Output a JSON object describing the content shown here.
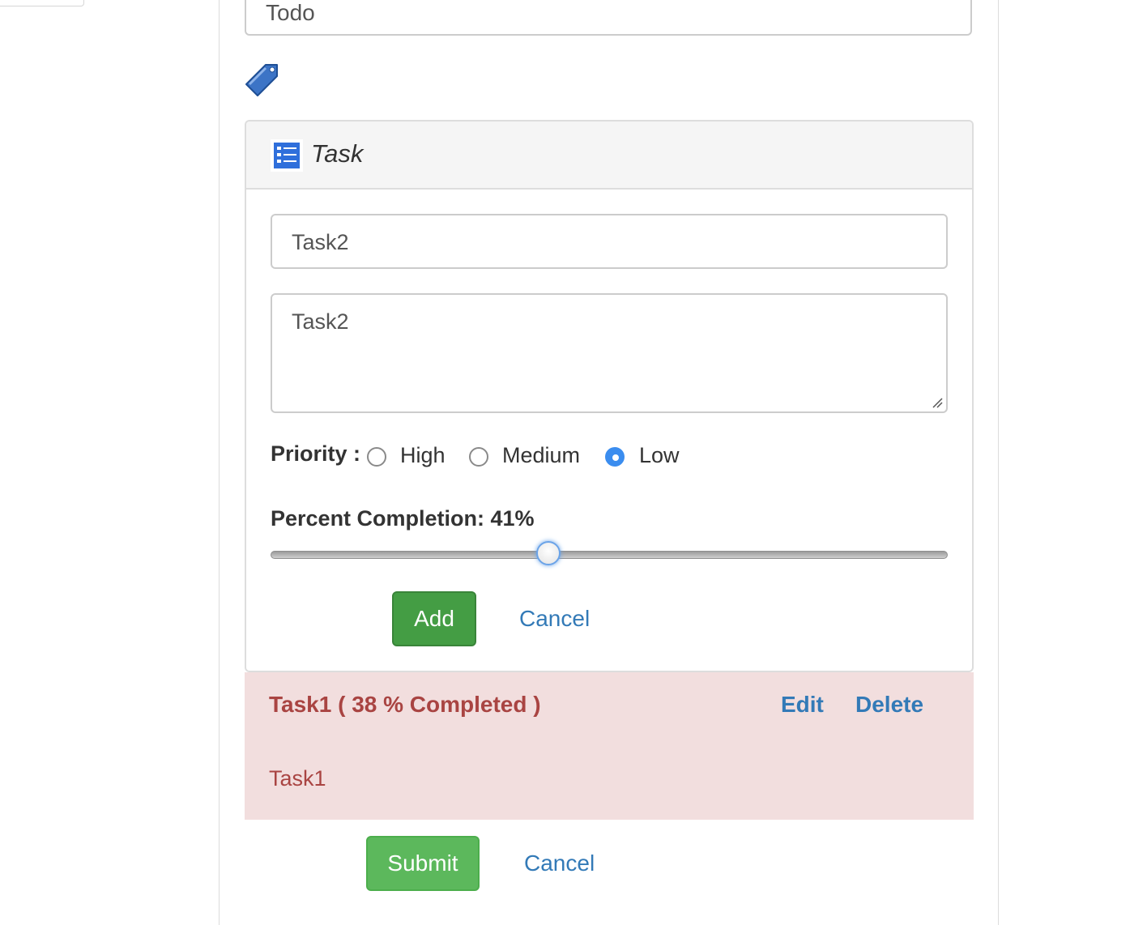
{
  "todo": {
    "value": "Todo"
  },
  "icons": {
    "tag": "tag-icon",
    "task": "task-list-icon"
  },
  "panel": {
    "title": "Task"
  },
  "form": {
    "name_value": "Task2",
    "description_value": "Task2",
    "priority_label": "Priority :",
    "priority_options": [
      "High",
      "Medium",
      "Low"
    ],
    "priority_selected": "Low",
    "percent_label": "Percent Completion: 41%",
    "percent_value": 41,
    "add_label": "Add",
    "cancel_label": "Cancel"
  },
  "tasks": [
    {
      "title": "Task1 ( 38 % Completed )",
      "description": "Task1",
      "edit_label": "Edit",
      "delete_label": "Delete"
    }
  ],
  "footer": {
    "submit_label": "Submit",
    "cancel_label": "Cancel"
  },
  "colors": {
    "add_button": "#449d44",
    "submit_button": "#5cb85c",
    "link": "#337ab7",
    "task_item_bg": "#f2dede",
    "task_item_text": "#a94442",
    "radio_checked": "#3b8def"
  }
}
